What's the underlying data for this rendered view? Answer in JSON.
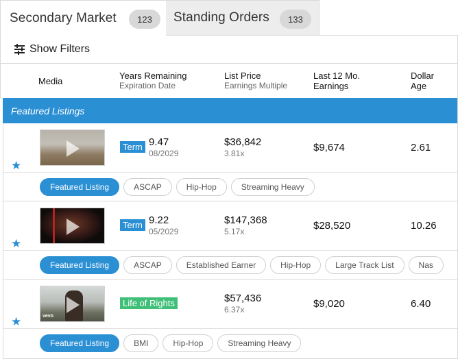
{
  "tabs": [
    {
      "label": "Secondary Market",
      "count": "123"
    },
    {
      "label": "Standing Orders",
      "count": "133"
    }
  ],
  "filters": {
    "label": "Show Filters"
  },
  "columns": {
    "media": "Media",
    "years_main": "Years Remaining",
    "years_sub": "Expiration Date",
    "price_main": "List Price",
    "price_sub": "Earnings Multiple",
    "earn_line1": "Last 12 Mo.",
    "earn_line2": "Earnings",
    "age_line1": "Dollar",
    "age_line2": "Age"
  },
  "featured_banner": "Featured Listings",
  "listings": [
    {
      "type": "Term",
      "years": "9.47",
      "expiration": "08/2029",
      "price": "$36,842",
      "multiple": "3.81x",
      "earnings": "$9,674",
      "age": "2.61",
      "tags": [
        "Featured Listing",
        "ASCAP",
        "Hip-Hop",
        "Streaming Heavy"
      ]
    },
    {
      "type": "Term",
      "years": "9.22",
      "expiration": "05/2029",
      "price": "$147,368",
      "multiple": "5.17x",
      "earnings": "$28,520",
      "age": "10.26",
      "tags": [
        "Featured Listing",
        "ASCAP",
        "Established Earner",
        "Hip-Hop",
        "Large Track List",
        "Nas"
      ]
    },
    {
      "type": "Life of Rights",
      "years": "",
      "expiration": "",
      "price": "$57,436",
      "multiple": "6.37x",
      "earnings": "$9,020",
      "age": "6.40",
      "tags": [
        "Featured Listing",
        "BMI",
        "Hip-Hop",
        "Streaming Heavy"
      ]
    }
  ],
  "thumbnail_watermark": "vevo",
  "colors": {
    "accent": "#2b8fd4",
    "life_of_rights": "#3fbf78"
  }
}
